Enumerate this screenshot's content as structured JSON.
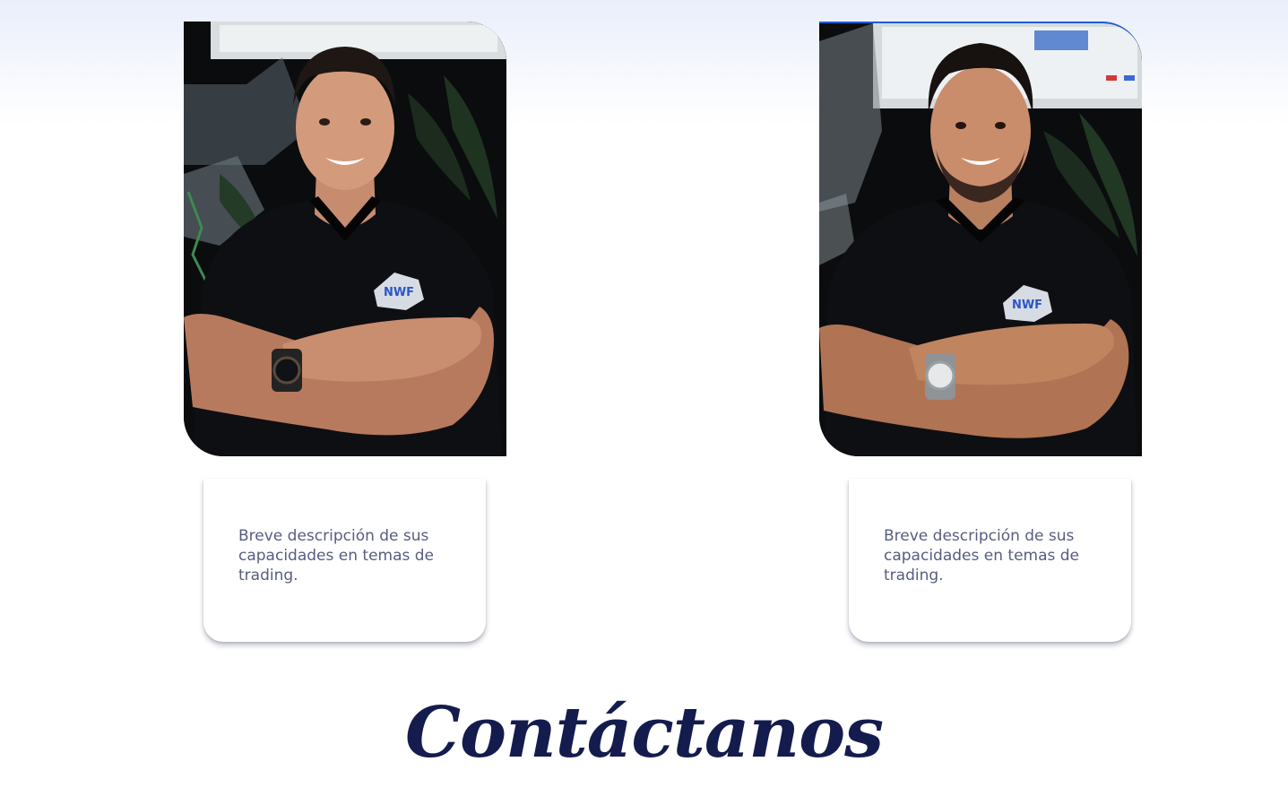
{
  "team": [
    {
      "photo_icon": "person-portrait",
      "description": "Breve descripción de sus capacidades en temas de trading."
    },
    {
      "photo_icon": "person-portrait",
      "description": "Breve descripción de sus capacidades en temas de trading."
    }
  ],
  "contact": {
    "title": "Contáctanos"
  },
  "colors": {
    "title": "#141c4e",
    "description_text": "#585c82",
    "accent_border": "#1f5fd6"
  }
}
